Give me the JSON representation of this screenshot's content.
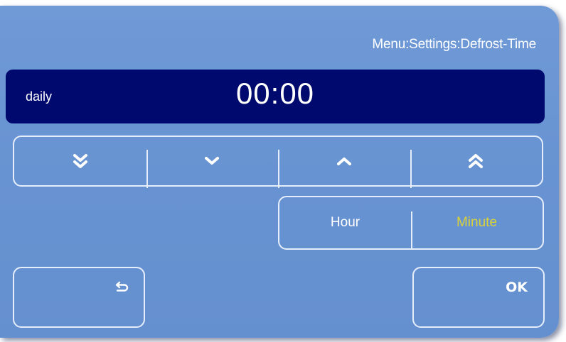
{
  "header": {
    "breadcrumb": "Menu:Settings:Defrost-Time"
  },
  "display": {
    "mode_label": "daily",
    "time": "00:00",
    "background_color": "#000a6e"
  },
  "stepper": {
    "buttons": [
      {
        "icon": "double-chevron-down-icon",
        "action": "fast-decrease"
      },
      {
        "icon": "chevron-down-icon",
        "action": "decrease"
      },
      {
        "icon": "chevron-up-icon",
        "action": "increase"
      },
      {
        "icon": "double-chevron-up-icon",
        "action": "fast-increase"
      }
    ]
  },
  "unit_selector": {
    "options": [
      "Hour",
      "Minute"
    ],
    "selected": "Minute",
    "selected_color": "#d8d23a"
  },
  "footer": {
    "back_icon": "return-arrow-icon",
    "ok_label": "OK"
  },
  "colors": {
    "panel": "#6893d2",
    "border": "#e6eefb",
    "text": "#ffffff"
  }
}
